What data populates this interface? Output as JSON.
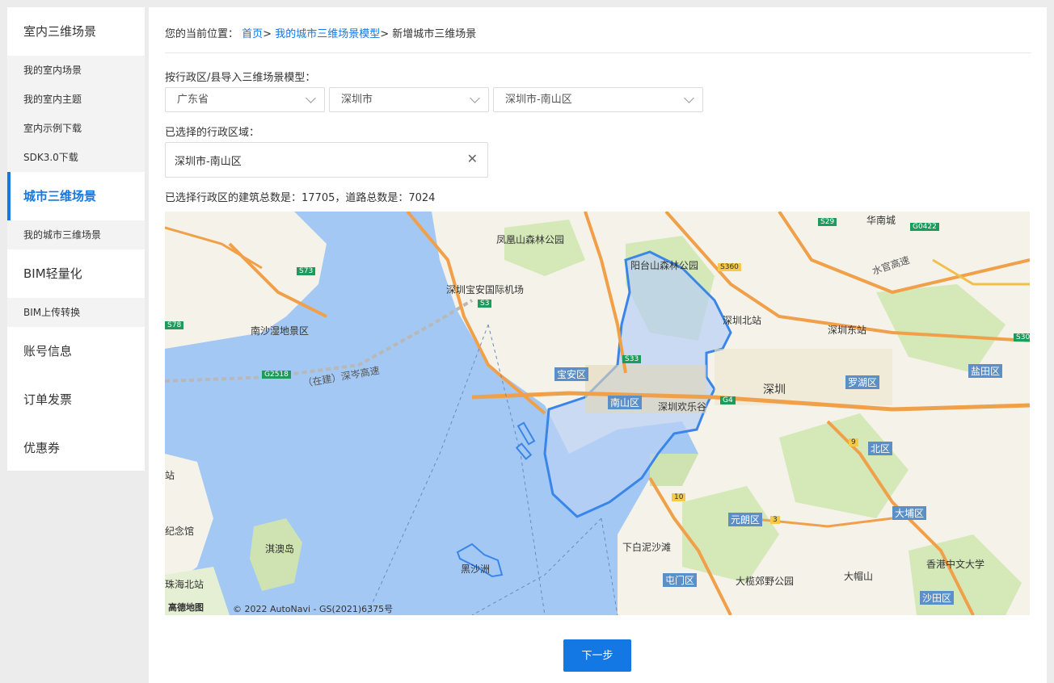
{
  "sidebar": {
    "sections": [
      {
        "label": "室内三维场景",
        "items": [
          "我的室内场景",
          "我的室内主题",
          "室内示例下载",
          "SDK3.0下载"
        ]
      },
      {
        "label": "城市三维场景",
        "active": true,
        "items": [
          "我的城市三维场景"
        ]
      },
      {
        "label": "BIM轻量化",
        "items": [
          "BIM上传转换"
        ]
      },
      {
        "label": "账号信息",
        "items": []
      },
      {
        "label": "订单发票",
        "items": []
      },
      {
        "label": "优惠券",
        "items": []
      }
    ]
  },
  "breadcrumb": {
    "prefix": "您的当前位置：",
    "home": "首页",
    "sep1": ">",
    "level2": "我的城市三维场景模型",
    "sep2": ">",
    "current": "新增城市三维场景"
  },
  "import": {
    "label": "按行政区/县导入三维场景模型：",
    "province": "广东省",
    "city": "深圳市",
    "district": "深圳市-南山区"
  },
  "selected": {
    "label": "已选择的行政区域：",
    "value": "深圳市-南山区",
    "remove_icon": "close-icon"
  },
  "stats": "已选择行政区的建筑总数是：17705，道路总数是：7024",
  "map": {
    "copyright": "© 2022 AutoNavi - GS(2021)6375号",
    "logo": "高德地图",
    "labels": [
      "凤凰山森林公园",
      "阳台山森林公园",
      "深圳宝安国际机场",
      "南沙湿地景区",
      "宝安区",
      "南山区",
      "深圳欢乐谷",
      "深圳北站",
      "深圳东站",
      "华南城",
      "深圳",
      "罗湖区",
      "盐田区",
      "北区",
      "元朗区",
      "大埔区",
      "屯门区",
      "下白泥沙滩",
      "大榄郊野公园",
      "大帽山",
      "香港中文大学",
      "沙田区",
      "淇澳岛",
      "黑沙洲",
      "（在建）深岑高速",
      "水官高速",
      "站",
      "纪念馆",
      "珠海北站"
    ],
    "road_codes": [
      "S73",
      "S78",
      "S33",
      "S3",
      "S360",
      "S29",
      "G0422",
      "G2518",
      "G4",
      "9",
      "10",
      "3",
      "S30"
    ]
  },
  "next_button": "下一步"
}
